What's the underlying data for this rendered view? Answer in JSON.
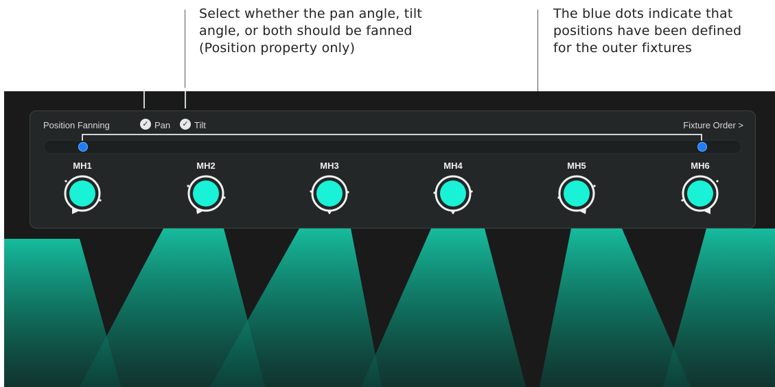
{
  "callouts": {
    "left": {
      "line1": "Select whether the pan angle, tilt",
      "line2": "angle, or both should be fanned",
      "line3": "(Position property only)"
    },
    "right": {
      "line1": "The blue dots indicate that",
      "line2": "positions have been defined",
      "line3": "for the outer fixtures"
    }
  },
  "panel": {
    "title": "Position Fanning",
    "pan_label": "Pan",
    "tilt_label": "Tilt",
    "pan_checked": true,
    "tilt_checked": true,
    "fixture_order_label": "Fixture Order >"
  },
  "fixtures": [
    {
      "label": "MH1"
    },
    {
      "label": "MH2"
    },
    {
      "label": "MH3"
    },
    {
      "label": "MH4"
    },
    {
      "label": "MH5"
    },
    {
      "label": "MH6"
    }
  ],
  "colors": {
    "accent": "#19f2d6",
    "beam": "#0f9e84",
    "dot": "#1e7ef7",
    "background": "#1a1a1a"
  }
}
